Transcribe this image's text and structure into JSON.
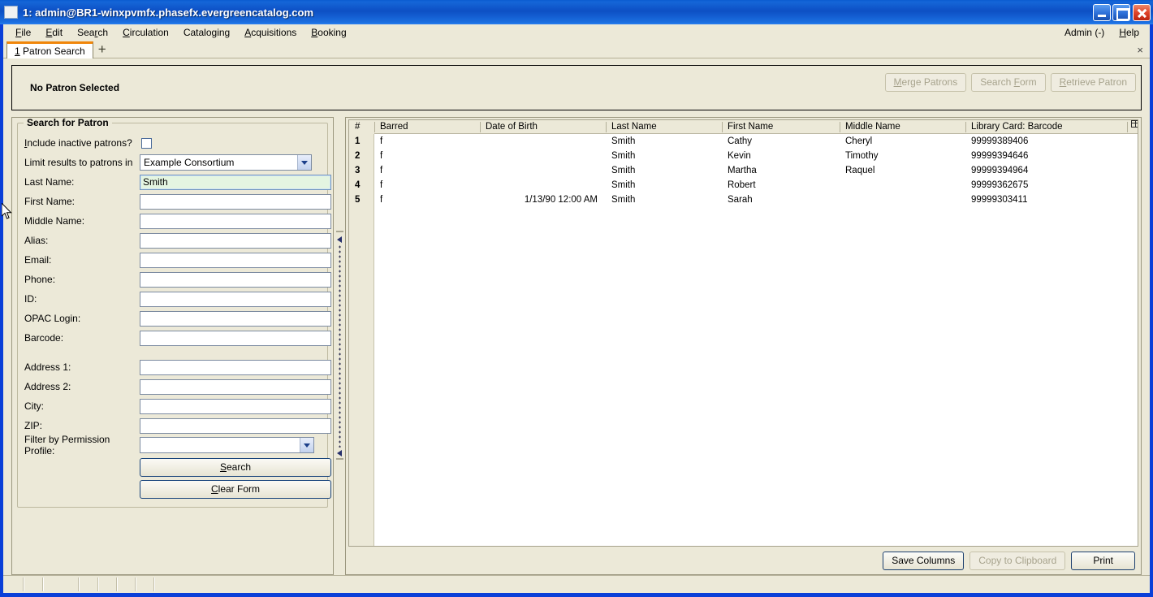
{
  "window": {
    "title": "1: admin@BR1-winxpvmfx.phasefx.evergreencatalog.com",
    "minimize_label": "",
    "maximize_label": "",
    "close_label": ""
  },
  "menubar": {
    "items": [
      {
        "label": "File",
        "accel": "F"
      },
      {
        "label": "Edit",
        "accel": "E"
      },
      {
        "label": "Search",
        "accel": "r"
      },
      {
        "label": "Circulation",
        "accel": "C"
      },
      {
        "label": "Cataloging",
        "accel": "g"
      },
      {
        "label": "Acquisitions",
        "accel": "A"
      },
      {
        "label": "Booking",
        "accel": "B"
      }
    ],
    "right": [
      {
        "label": "Admin (-)"
      },
      {
        "label": "Help"
      }
    ]
  },
  "tabs": {
    "active": "1 Patron Search",
    "new_tab_label": "+",
    "close_label": "×"
  },
  "patron_bar": {
    "status": "No Patron Selected",
    "buttons": [
      {
        "label": "Merge Patrons",
        "disabled": true
      },
      {
        "label": "Search Form",
        "disabled": true
      },
      {
        "label": "Retrieve Patron",
        "disabled": true
      }
    ]
  },
  "search_form": {
    "group_title": "Search for Patron",
    "include_inactive_label": "Include inactive patrons?",
    "include_inactive_checked": false,
    "limit_results_label": "Limit results to patrons in",
    "limit_results_value": "Example Consortium",
    "fields": [
      {
        "label": "Last Name:",
        "value": "Smith",
        "filled": true
      },
      {
        "label": "First Name:",
        "value": "",
        "filled": false
      },
      {
        "label": "Middle Name:",
        "value": "",
        "filled": false
      },
      {
        "label": "Alias:",
        "value": "",
        "filled": false
      },
      {
        "label": "Email:",
        "value": "",
        "filled": false
      },
      {
        "label": "Phone:",
        "value": "",
        "filled": false
      },
      {
        "label": "ID:",
        "value": "",
        "filled": false
      },
      {
        "label": "OPAC Login:",
        "value": "",
        "filled": false
      },
      {
        "label": "Barcode:",
        "value": "",
        "filled": false
      }
    ],
    "address_fields": [
      {
        "label": "Address 1:",
        "value": ""
      },
      {
        "label": "Address 2:",
        "value": ""
      },
      {
        "label": "City:",
        "value": ""
      },
      {
        "label": "ZIP:",
        "value": ""
      }
    ],
    "permission_profile_label": "Filter by Permission Profile:",
    "permission_profile_value": "",
    "search_button": "Search",
    "clear_button": "Clear Form"
  },
  "results": {
    "columns": [
      "#",
      "Barred",
      "Date of Birth",
      "Last Name",
      "First Name",
      "Middle Name",
      "Library Card: Barcode"
    ],
    "column_picker_icon": "column-picker-icon",
    "rows": [
      {
        "num": "1",
        "barred": "f",
        "dob": "",
        "last": "Smith",
        "first": "Cathy",
        "middle": "Cheryl",
        "barcode": "99999389406"
      },
      {
        "num": "2",
        "barred": "f",
        "dob": "",
        "last": "Smith",
        "first": "Kevin",
        "middle": "Timothy",
        "barcode": "99999394646"
      },
      {
        "num": "3",
        "barred": "f",
        "dob": "",
        "last": "Smith",
        "first": "Martha",
        "middle": "Raquel",
        "barcode": "99999394964"
      },
      {
        "num": "4",
        "barred": "f",
        "dob": "",
        "last": "Smith",
        "first": "Robert",
        "middle": "",
        "barcode": "99999362675"
      },
      {
        "num": "5",
        "barred": "f",
        "dob": "1/13/90 12:00 AM",
        "last": "Smith",
        "first": "Sarah",
        "middle": "",
        "barcode": "99999303411"
      }
    ],
    "footer_buttons": [
      {
        "label": "Save Columns",
        "disabled": false,
        "strong": true
      },
      {
        "label": "Copy to Clipboard",
        "disabled": true,
        "strong": false
      },
      {
        "label": "Print",
        "disabled": false,
        "strong": true
      }
    ]
  },
  "colors": {
    "window_frame": "#0a3fd8",
    "chrome": "#ece9d8",
    "tab_accent": "#f0860a",
    "filled_field": "#e4f5e1"
  }
}
